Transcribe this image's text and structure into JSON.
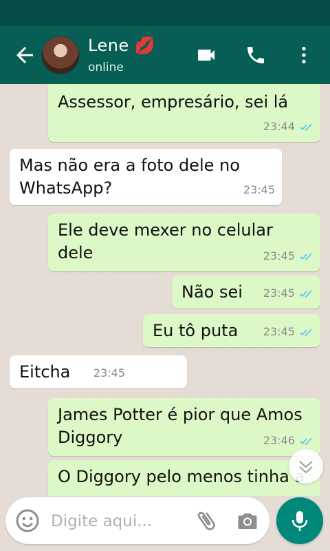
{
  "header": {
    "contact_name": "Lene 💋",
    "status": "online"
  },
  "messages": [
    {
      "direction": "out",
      "text": "Assessor, empresário, sei lá",
      "time": "23:44",
      "ticks": "read"
    },
    {
      "direction": "in",
      "text": "Mas não era a foto dele no WhatsApp?",
      "time": "23:45"
    },
    {
      "direction": "out",
      "text": "Ele deve mexer no celular dele",
      "time": "23:45",
      "ticks": "read"
    },
    {
      "direction": "out",
      "text": "Não sei",
      "time": "23:45",
      "ticks": "read"
    },
    {
      "direction": "out",
      "text": "Eu tô puta",
      "time": "23:45",
      "ticks": "read"
    },
    {
      "direction": "in",
      "text": "Eitcha",
      "time": "23:45"
    },
    {
      "direction": "out",
      "text": "James Potter é pior que Amos Diggory",
      "time": "23:46",
      "ticks": "read"
    },
    {
      "direction": "out",
      "text": "O Diggory pelo menos tinha a",
      "time": "",
      "ticks": ""
    }
  ],
  "input": {
    "placeholder": "Digite aqui..."
  },
  "colors": {
    "header": "#075e54",
    "status_bar": "#054d44",
    "outgoing": "#dcf8c6",
    "incoming": "#ffffff",
    "accent": "#00897b",
    "read_tick": "#4fc3f7"
  },
  "icons": [
    "back-arrow-icon",
    "video-call-icon",
    "phone-icon",
    "more-vert-icon",
    "emoji-icon",
    "attach-icon",
    "camera-icon",
    "mic-icon",
    "scroll-down-icon",
    "read-tick-icon"
  ]
}
